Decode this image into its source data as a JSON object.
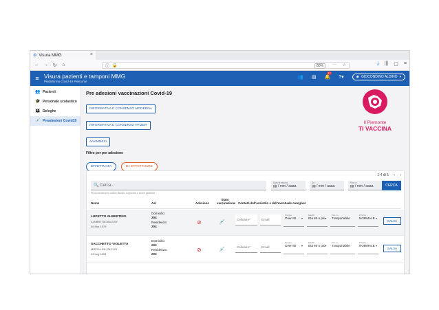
{
  "browser": {
    "tab_title": "Visura MMG",
    "tab_close": "×",
    "zoom": "80%",
    "url_more": "···",
    "nav_icons": [
      "back-icon",
      "forward-icon",
      "reload-icon",
      "home-icon"
    ]
  },
  "header": {
    "title": "Visura pazienti e tamponi MMG",
    "subtitle": "Piattaforma Covid-19 Piemonte",
    "notification_count": "17",
    "user_name": "GIOCONDINO ALDINO"
  },
  "sidebar": {
    "items": [
      {
        "label": "Pazienti",
        "icon": "people-icon"
      },
      {
        "label": "Personale scolastico",
        "icon": "school-icon"
      },
      {
        "label": "Deleghe",
        "icon": "group-icon"
      },
      {
        "label": "Preadesioni Covid19",
        "icon": "syringe-icon"
      }
    ]
  },
  "main": {
    "title": "Pre adesioni vaccinazioni Covid-19",
    "buttons": {
      "moderna": "INFORMATIVA E CONSENSO MODERNA",
      "pfizer": "INFORMATIVA E CONSENSO PFIZER",
      "anamnesi": "ANAMNESI"
    },
    "logo": {
      "line1": "Il Piemonte",
      "line2": "TI VACCINA"
    },
    "filter_label": "Filtro per pre adesione",
    "filters": {
      "done": "EFFETTUATA",
      "todo": "DA EFFETTUARE"
    }
  },
  "table": {
    "pager_text": "1-4 di 5",
    "pager_prev": "‹",
    "pager_next": "›",
    "search_placeholder": "Cerca...",
    "search_hint": "Puoi cercare per codice fiscale, cognome o nome paziente",
    "dates": [
      {
        "label": "Data di nascita",
        "value": "gg / mm / aaaa"
      },
      {
        "label": "Da",
        "value": "gg / mm / aaaa"
      },
      {
        "label": "Fino a",
        "value": "gg / mm / aaaa"
      }
    ],
    "search_button": "CERCA",
    "headers": {
      "name": "Nome",
      "asl": "Asl",
      "adesione": "Adesione",
      "stato": "Stato vaccinazione",
      "contatti": "Contatti dell'assistito e dell'eventuale caregiver"
    },
    "rows": [
      {
        "name": "LUPETTO ALBERTINO",
        "cf": "XLNBRT75C06L219Y",
        "date": "06 Mar 1975",
        "dom_label": "Domicilio:",
        "dom_value": "204",
        "res_label": "Residenza:",
        "res_value": "204",
        "cell_placeholder": "Cellulare*",
        "email_placeholder": "Email",
        "gruppo_label": "Gruppo",
        "gruppo_value": "Over 80",
        "eta_label": "Età 80",
        "eta_value": "Età 80 o più",
        "cat_label": "Cat. m...",
        "cat_value": "Trasportabile",
        "prio_label": "Priorità",
        "prio_value": "NORMALE",
        "save": "SALVA"
      },
      {
        "name": "SACCHETTO VIOLETTA",
        "cf": "MRVVLL93L23L219Y",
        "date": "23 Lug 1993",
        "dom_label": "Domicilio:",
        "dom_value": "203",
        "res_label": "Residenza:",
        "res_value": "203",
        "cell_placeholder": "Cellulare*",
        "email_placeholder": "Email",
        "gruppo_label": "Gruppo",
        "gruppo_value": "Over 80",
        "eta_label": "Età 80",
        "eta_value": "Età 80 o più",
        "cat_label": "Cat. m...",
        "cat_value": "Trasportabile",
        "prio_label": "Priorità",
        "prio_value": "NORMALE",
        "save": "SALVA"
      }
    ]
  }
}
